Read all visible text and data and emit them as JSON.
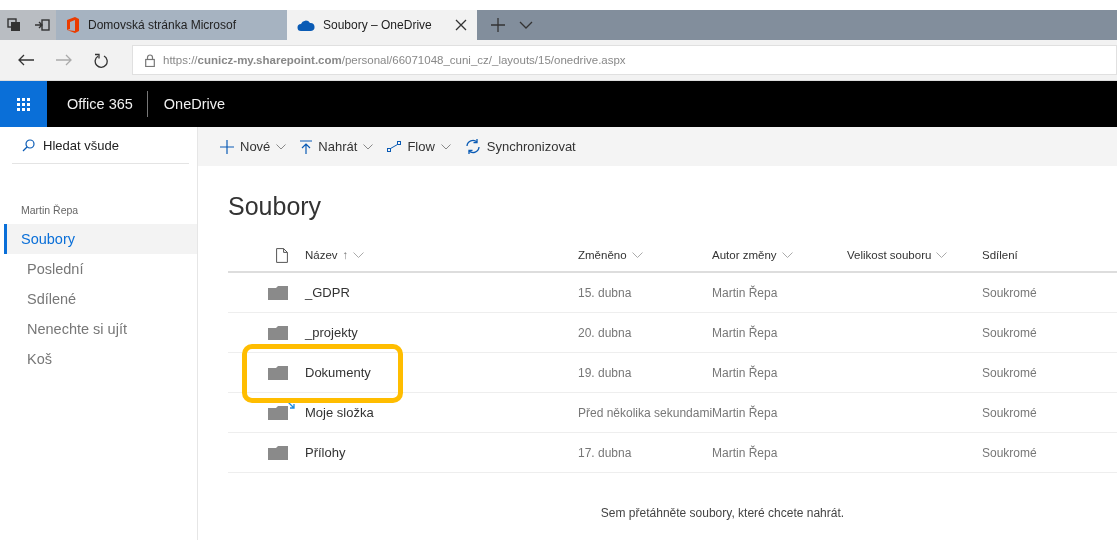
{
  "browser": {
    "tabs": [
      {
        "kind": "office",
        "title": "Domovská stránka Microsof",
        "selected": false,
        "closable": false
      },
      {
        "kind": "onedrive",
        "title": "Soubory – OneDrive",
        "selected": true,
        "closable": true
      }
    ],
    "url": "https://**cunicz-my.sharepoint.com**/personal/66071048_cuni_cz/_layouts/15/onedrive.aspx"
  },
  "suite_bar": {
    "brand": "Office 365",
    "app": "OneDrive"
  },
  "sidebar": {
    "search": {
      "placeholder": "Hledat všude"
    },
    "user": "Martin Řepa",
    "items": [
      {
        "label": "Soubory",
        "selected": true
      },
      {
        "label": "Poslední",
        "selected": false
      },
      {
        "label": "Sdílené",
        "selected": false
      },
      {
        "label": "Nenechte si ujít",
        "selected": false
      },
      {
        "label": "Koš",
        "selected": false
      }
    ]
  },
  "command_bar": [
    {
      "kind": "plus",
      "label": "Nové",
      "dropdown": true
    },
    {
      "kind": "upload",
      "label": "Nahrát",
      "dropdown": true
    },
    {
      "kind": "flow",
      "label": "Flow",
      "dropdown": true
    },
    {
      "kind": "sync",
      "label": "Synchronizovat",
      "dropdown": false
    }
  ],
  "page_title": "Soubory",
  "table": {
    "columns": [
      {
        "label": "Název",
        "sort_arrow": "↑",
        "dropdown": true
      },
      {
        "label": "Změněno",
        "dropdown": true
      },
      {
        "label": "Autor změny",
        "dropdown": true
      },
      {
        "label": "Velikost souboru",
        "dropdown": true
      },
      {
        "label": "Sdílení",
        "dropdown": false
      }
    ],
    "rows": [
      {
        "name": "_GDPR",
        "modified": "15. dubna",
        "author": "Martin Řepa",
        "sharing": "Soukromé",
        "highlighted": false,
        "syncing": false
      },
      {
        "name": "_projekty",
        "modified": "20. dubna",
        "author": "Martin Řepa",
        "sharing": "Soukromé",
        "highlighted": false,
        "syncing": false
      },
      {
        "name": "Dokumenty",
        "modified": "19. dubna",
        "author": "Martin Řepa",
        "sharing": "Soukromé",
        "highlighted": true,
        "syncing": false
      },
      {
        "name": "Moje složka",
        "modified": "Před několika sekundami",
        "author": "Martin Řepa",
        "sharing": "Soukromé",
        "highlighted": false,
        "syncing": true
      },
      {
        "name": "Přílohy",
        "modified": "17. dubna",
        "author": "Martin Řepa",
        "sharing": "Soukromé",
        "highlighted": false,
        "syncing": false
      }
    ]
  },
  "drop_hint": "Sem přetáhněte soubory, které chcete nahrát."
}
